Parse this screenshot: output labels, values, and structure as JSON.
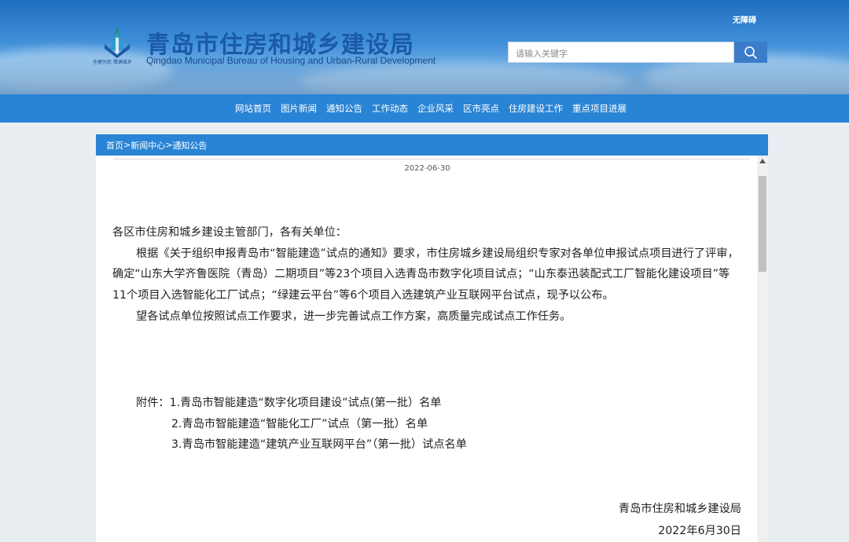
{
  "header": {
    "title": "青岛市住房和城乡建设局",
    "subtitle": "Qingdao Municipal Bureau of Housing and Urban-Rural Development",
    "slogan": "住建为民 情满城乡",
    "accessibility": "无障碍",
    "search": {
      "placeholder": "请输入关键字",
      "icon": "search-icon"
    }
  },
  "nav": {
    "items": [
      "网站首页",
      "图片新闻",
      "通知公告",
      "工作动态",
      "企业风采",
      "区市亮点",
      "住房建设工作",
      "重点项目进展"
    ]
  },
  "breadcrumb": {
    "items": [
      "首页",
      "新闻中心",
      "通知公告"
    ],
    "separator": ">"
  },
  "article": {
    "date": "2022-06-30",
    "greeting": "各区市住房和城乡建设主管部门，各有关单位：",
    "paragraph1": "根据《关于组织申报青岛市“智能建造”试点的通知》要求，市住房城乡建设局组织专家对各单位申报试点项目进行了评审，确定“山东大学齐鲁医院（青岛）二期项目”等23个项目入选青岛市数字化项目试点；“山东泰迅装配式工厂智能化建设项目”等11个项目入选智能化工厂试点；“绿建云平台”等6个项目入选建筑产业互联网平台试点，现予以公布。",
    "paragraph2": "望各试点单位按照试点工作要求，进一步完善试点工作方案，高质量完成试点工作任务。",
    "attachments_label": "附件：",
    "attachments": [
      "1.青岛市智能建造“数字化项目建设”试点(第一批）名单",
      "2.青岛市智能建造“智能化工厂”试点（第一批）名单",
      "3.青岛市智能建造“建筑产业互联网平台”（第一批）试点名单"
    ],
    "signature_org": "青岛市住房和城乡建设局",
    "signature_date": "2022年6月30日"
  },
  "colors": {
    "primary": "#2a84d5",
    "title_blue": "#1b5aa8",
    "search_button": "#3b7cc9"
  }
}
